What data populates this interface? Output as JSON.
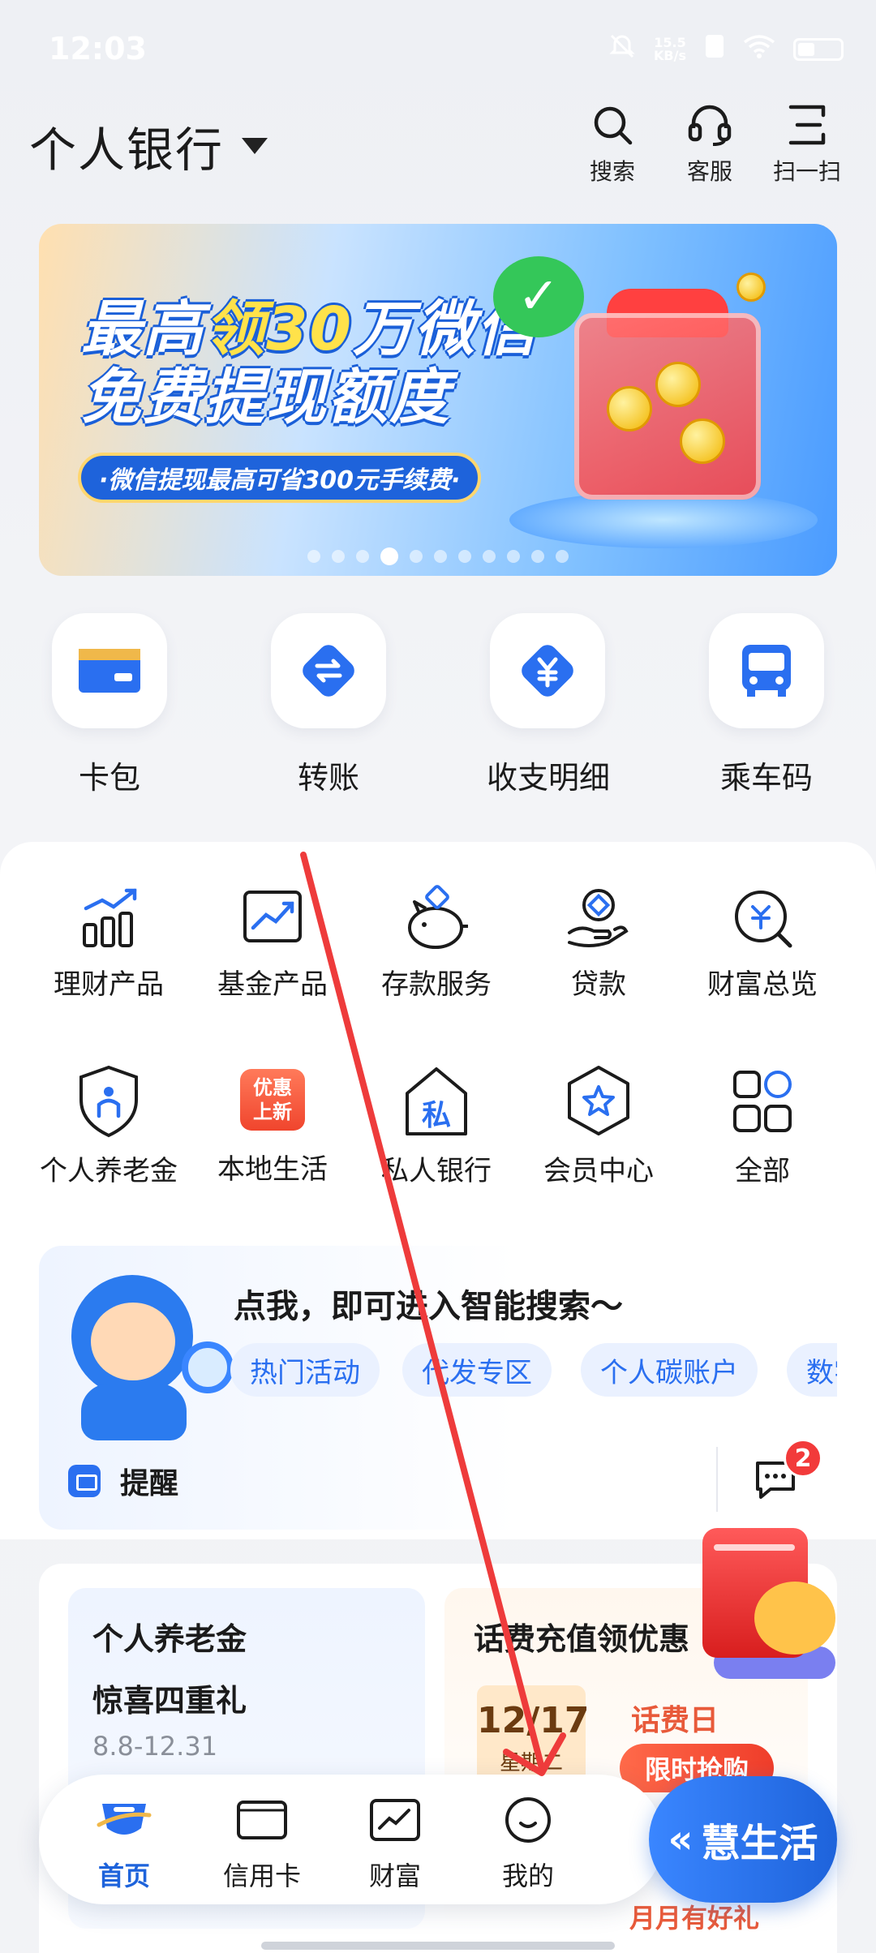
{
  "status_bar": {
    "time": "12:03",
    "net_speed_value": "15.5",
    "net_speed_unit": "KB/s"
  },
  "header": {
    "title": "个人银行",
    "actions": [
      {
        "icon": "search-icon",
        "label": "搜索"
      },
      {
        "icon": "headset-icon",
        "label": "客服"
      },
      {
        "icon": "scan-icon",
        "label": "扫一扫"
      }
    ]
  },
  "banner": {
    "title_line1_a": "最高",
    "title_line1_hl": "领30",
    "title_line1_b": "万微信",
    "title_line2": "免费提现额度",
    "pill": "·微信提现最高可省300元手续费·",
    "page_count": 11,
    "active_index": 3
  },
  "quick_actions": [
    {
      "icon": "card-wallet-icon",
      "label": "卡包"
    },
    {
      "icon": "transfer-icon",
      "label": "转账"
    },
    {
      "icon": "yuan-detail-icon",
      "label": "收支明细"
    },
    {
      "icon": "bus-icon",
      "label": "乘车码"
    }
  ],
  "services": [
    {
      "icon": "bar-chart-icon",
      "label": "理财产品"
    },
    {
      "icon": "trend-chart-icon",
      "label": "基金产品"
    },
    {
      "icon": "piggy-bank-icon",
      "label": "存款服务"
    },
    {
      "icon": "hand-coin-icon",
      "label": "贷款"
    },
    {
      "icon": "wealth-search-icon",
      "label": "财富总览"
    },
    {
      "icon": "shield-person-icon",
      "label": "个人养老金"
    },
    {
      "icon": "promo-badge-icon",
      "label": "本地生活",
      "badge_line1": "优惠",
      "badge_line2": "上新"
    },
    {
      "icon": "house-private-icon",
      "label": "私人银行",
      "glyph": "私"
    },
    {
      "icon": "hexagon-star-icon",
      "label": "会员中心"
    },
    {
      "icon": "grid-all-icon",
      "label": "全部"
    }
  ],
  "smart_search": {
    "title": "点我，即可进入智能搜索～",
    "chips": [
      "热门活动",
      "代发专区",
      "个人碳账户",
      "数字"
    ],
    "reminder_label": "提醒",
    "message_count": "2"
  },
  "promos": {
    "left": {
      "title": "个人养老金",
      "subtitle": "惊喜四重礼",
      "date": "8.8-12.31"
    },
    "right": {
      "title": "话费充值领优惠",
      "cal_date": "12/17",
      "cal_weekday": "星期二",
      "highlight": "话费日",
      "button": "限时抢购",
      "footer": "月月有好礼"
    }
  },
  "bottom_nav": {
    "items": [
      {
        "icon": "home-icon",
        "label": "首页",
        "active": true
      },
      {
        "icon": "credit-card-icon",
        "label": "信用卡"
      },
      {
        "icon": "wealth-icon",
        "label": "财富"
      },
      {
        "icon": "profile-icon",
        "label": "我的"
      }
    ],
    "life_button": "慧生活",
    "life_chevron": "«"
  },
  "colors": {
    "brand_blue": "#1e63db",
    "accent_red": "#f23a3a",
    "annotation_red": "#ee3b3b"
  }
}
